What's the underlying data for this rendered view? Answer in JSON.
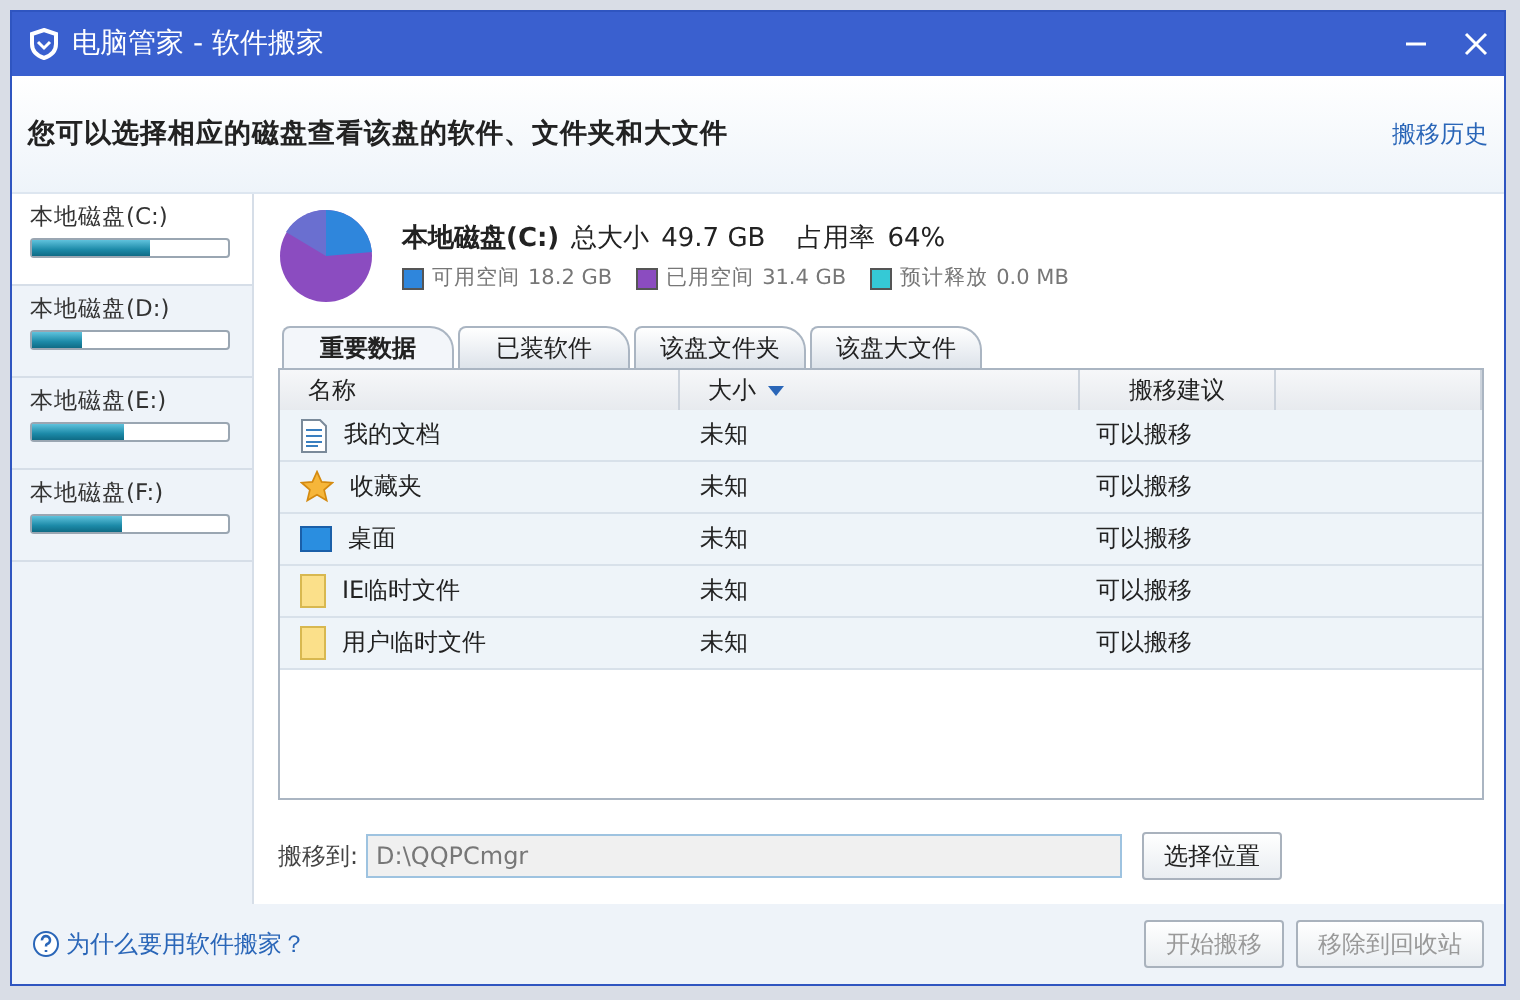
{
  "window": {
    "title": "电脑管家 - 软件搬家"
  },
  "header": {
    "text": "您可以选择相应的磁盘查看该盘的软件、文件夹和大文件",
    "link": "搬移历史"
  },
  "drives": [
    {
      "name": "本地磁盘(C:)",
      "level": 0.6,
      "selected": true
    },
    {
      "name": "本地磁盘(D:)",
      "level": 0.26,
      "selected": false
    },
    {
      "name": "本地磁盘(E:)",
      "level": 0.47,
      "selected": false
    },
    {
      "name": "本地磁盘(F:)",
      "level": 0.46,
      "selected": false
    }
  ],
  "disk": {
    "name": "本地磁盘(C:)",
    "total_label": "总大小",
    "total": "49.7 GB",
    "usage_label": "占用率",
    "usage": "64%",
    "legend": [
      {
        "label": "可用空间",
        "value": "18.2 GB",
        "color": "#2f86dc"
      },
      {
        "label": "已用空间",
        "value": "31.4 GB",
        "color": "#8b4cc0"
      },
      {
        "label": "预计释放",
        "value": "0.0 MB",
        "color": "#35c9d6"
      }
    ]
  },
  "tabs": [
    {
      "label": "重要数据",
      "selected": true
    },
    {
      "label": "已装软件",
      "selected": false
    },
    {
      "label": "该盘文件夹",
      "selected": false
    },
    {
      "label": "该盘大文件",
      "selected": false
    }
  ],
  "table": {
    "columns": [
      "名称",
      "大小",
      "搬移建议"
    ],
    "rows": [
      {
        "kind": "document",
        "name": "我的文档",
        "size": "未知",
        "advice": "可以搬移"
      },
      {
        "kind": "star",
        "name": "收藏夹",
        "size": "未知",
        "advice": "可以搬移"
      },
      {
        "kind": "desktop",
        "name": "桌面",
        "size": "未知",
        "advice": "可以搬移"
      },
      {
        "kind": "folder",
        "name": "IE临时文件",
        "size": "未知",
        "advice": "可以搬移"
      },
      {
        "kind": "folder",
        "name": "用户临时文件",
        "size": "未知",
        "advice": "可以搬移"
      }
    ]
  },
  "move_to": {
    "label": "搬移到:",
    "value": "D:\\QQPCmgr",
    "button": "选择位置"
  },
  "footer": {
    "help": "为什么要用软件搬家？",
    "buttons": [
      {
        "label": "开始搬移",
        "disabled": true
      },
      {
        "label": "移除到回收站",
        "disabled": true
      }
    ]
  }
}
